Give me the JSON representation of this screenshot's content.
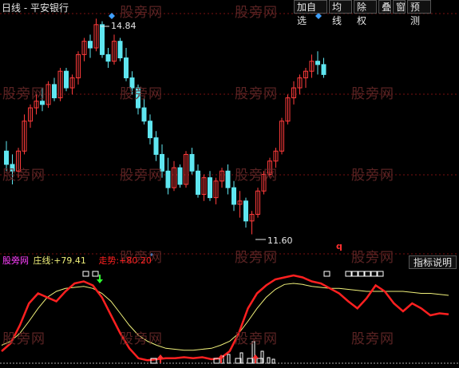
{
  "app": {
    "title": "日线 - 平安银行"
  },
  "toolbar": {
    "buttons": [
      {
        "label": "加自选",
        "name": "add-watchlist-button"
      },
      {
        "label": "均线",
        "name": "moving-average-button"
      },
      {
        "label": "除权",
        "name": "ex-rights-button"
      },
      {
        "label": "叠",
        "name": "overlay-button"
      },
      {
        "label": "窗",
        "name": "window-button"
      },
      {
        "label": "预测",
        "name": "forecast-button"
      }
    ]
  },
  "watermark": {
    "text": "股旁网"
  },
  "price_panel": {
    "high_label": "14.84",
    "low_label": "11.60",
    "marker_text": "q"
  },
  "indicator": {
    "name": "股旁网",
    "line1_label": "庄线:",
    "line1_value": "+79.41",
    "line2_label": "走势:",
    "line2_value": "+80.20",
    "explain_button": "指标说明"
  },
  "colors": {
    "up": "#ff3b3b",
    "down": "#5fe6f0",
    "zhuang_line": "#f0f07a",
    "zoushi_line": "#ff2020",
    "indicator_name": "#ff40ff",
    "grid": "#7a1010"
  },
  "chart_data": {
    "type": "candlestick",
    "ohlc": [
      [
        12.85,
        13.0,
        12.55,
        12.65
      ],
      [
        12.65,
        12.8,
        12.35,
        12.55
      ],
      [
        12.55,
        12.9,
        12.45,
        12.85
      ],
      [
        12.85,
        13.4,
        12.8,
        13.3
      ],
      [
        13.3,
        13.55,
        13.2,
        13.5
      ],
      [
        13.5,
        13.7,
        13.4,
        13.6
      ],
      [
        13.6,
        13.8,
        13.45,
        13.55
      ],
      [
        13.55,
        13.9,
        13.5,
        13.85
      ],
      [
        13.85,
        13.95,
        13.6,
        13.65
      ],
      [
        13.65,
        14.1,
        13.6,
        14.05
      ],
      [
        14.05,
        14.1,
        13.75,
        13.8
      ],
      [
        13.8,
        14.0,
        13.7,
        13.95
      ],
      [
        13.95,
        14.35,
        13.85,
        14.3
      ],
      [
        14.3,
        14.55,
        14.2,
        14.5
      ],
      [
        14.5,
        14.6,
        14.25,
        14.4
      ],
      [
        14.4,
        14.84,
        14.35,
        14.75
      ],
      [
        14.75,
        14.8,
        14.25,
        14.3
      ],
      [
        14.3,
        14.4,
        14.1,
        14.2
      ],
      [
        14.2,
        14.6,
        14.15,
        14.5
      ],
      [
        14.5,
        14.55,
        14.2,
        14.25
      ],
      [
        14.25,
        14.4,
        13.9,
        13.95
      ],
      [
        13.95,
        14.05,
        13.7,
        13.8
      ],
      [
        13.8,
        13.85,
        13.4,
        13.5
      ],
      [
        13.5,
        13.65,
        13.25,
        13.3
      ],
      [
        13.3,
        13.4,
        12.95,
        13.05
      ],
      [
        13.05,
        13.15,
        12.7,
        12.8
      ],
      [
        12.8,
        12.95,
        12.45,
        12.55
      ],
      [
        12.55,
        12.75,
        12.2,
        12.3
      ],
      [
        12.3,
        12.7,
        12.25,
        12.6
      ],
      [
        12.6,
        12.65,
        12.3,
        12.35
      ],
      [
        12.35,
        12.85,
        12.3,
        12.8
      ],
      [
        12.8,
        12.9,
        12.5,
        12.55
      ],
      [
        12.55,
        12.65,
        12.15,
        12.2
      ],
      [
        12.2,
        12.5,
        12.1,
        12.45
      ],
      [
        12.45,
        12.55,
        12.1,
        12.15
      ],
      [
        12.15,
        12.45,
        12.05,
        12.4
      ],
      [
        12.4,
        12.6,
        12.3,
        12.55
      ],
      [
        12.55,
        12.65,
        12.2,
        12.3
      ],
      [
        12.3,
        12.4,
        11.95,
        12.05
      ],
      [
        12.05,
        12.25,
        11.85,
        12.1
      ],
      [
        12.1,
        12.15,
        11.7,
        11.8
      ],
      [
        11.8,
        11.95,
        11.6,
        11.9
      ],
      [
        11.9,
        12.3,
        11.85,
        12.25
      ],
      [
        12.25,
        12.55,
        12.2,
        12.5
      ],
      [
        12.5,
        12.75,
        12.45,
        12.7
      ],
      [
        12.7,
        12.9,
        12.6,
        12.85
      ],
      [
        12.85,
        13.35,
        12.8,
        13.3
      ],
      [
        13.3,
        13.7,
        13.25,
        13.65
      ],
      [
        13.65,
        13.9,
        13.55,
        13.8
      ],
      [
        13.8,
        14.0,
        13.7,
        13.95
      ],
      [
        13.95,
        14.1,
        13.8,
        14.05
      ],
      [
        14.05,
        14.3,
        13.95,
        14.2
      ],
      [
        14.2,
        14.35,
        14.0,
        14.15
      ],
      [
        14.15,
        14.25,
        13.95,
        14.0
      ]
    ],
    "annotations": [
      {
        "text": "14.84",
        "type": "high"
      },
      {
        "text": "11.60",
        "type": "low"
      }
    ],
    "indicator_series": [
      {
        "name": "庄线",
        "values": [
          18,
          22,
          30,
          42,
          55,
          66,
          72,
          75,
          76,
          77,
          75,
          70,
          62,
          50,
          38,
          28,
          22,
          18,
          15,
          14,
          13,
          13,
          14,
          15,
          18,
          22,
          30,
          42,
          55,
          66,
          74,
          79,
          80,
          79,
          77,
          76,
          75,
          75,
          74,
          73,
          72,
          72,
          72,
          72,
          72,
          71,
          70,
          70,
          69,
          68
        ]
      },
      {
        "name": "走势",
        "values": [
          12,
          20,
          38,
          60,
          70,
          66,
          62,
          72,
          80,
          82,
          78,
          66,
          48,
          30,
          15,
          5,
          3,
          4,
          5,
          5,
          6,
          5,
          6,
          4,
          5,
          12,
          30,
          55,
          70,
          78,
          84,
          86,
          88,
          86,
          82,
          80,
          75,
          70,
          62,
          55,
          65,
          78,
          72,
          60,
          52,
          60,
          55,
          48,
          50,
          49
        ]
      }
    ]
  }
}
